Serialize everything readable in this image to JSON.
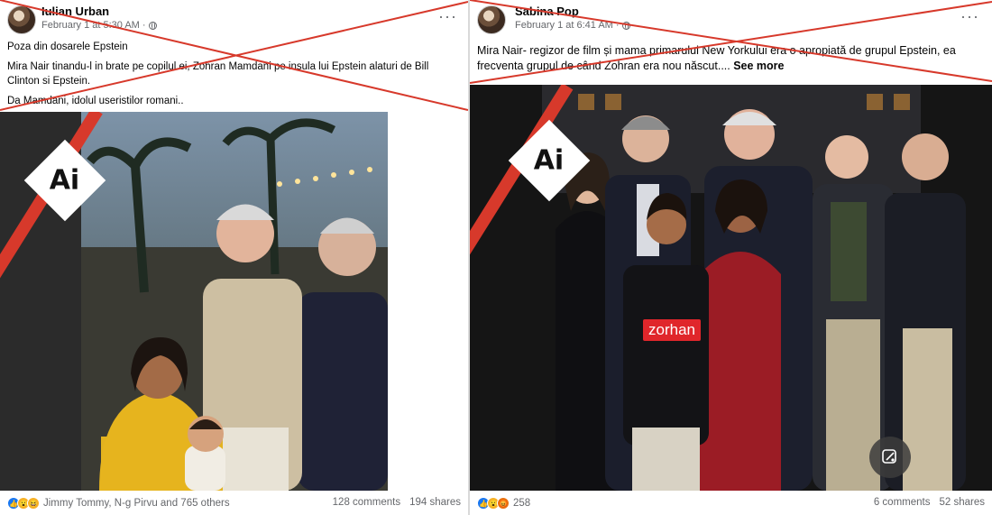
{
  "left_post": {
    "author": "Iulian Urban",
    "timestamp": "February 1 at 5:30 AM ·",
    "more": "···",
    "caption": [
      "Poza din dosarele Epstein",
      "Mira Nair tinandu-l in brate pe copilul ei, Zohran Mamdani pe insula lui Epstein alaturi de Bill Clinton si Epstein.",
      "Da Mamdani, idolul useristilor romani.."
    ],
    "ai_badge": "Ai",
    "reactions": "Jimmy Tommy, N-g Pirvu and 765 others",
    "comments": "128 comments",
    "shares": "194 shares",
    "cross_color": "#d7392b"
  },
  "right_post": {
    "author": "Sabina Pop",
    "timestamp": "February 1 at 6:41 AM ·",
    "more": "···",
    "caption": "Mira Nair- regizor de film și mama primarului New Yorkului era o apropiată de grupul Epstein, ea frecventa grupul de când Zohran era nou născut....",
    "see_more": "See more",
    "ai_badge": "Ai",
    "shirt_label": "zorhan",
    "reactions_count": "258",
    "comments": "6 comments",
    "shares": "52 shares",
    "cross_color": "#d7392b"
  }
}
